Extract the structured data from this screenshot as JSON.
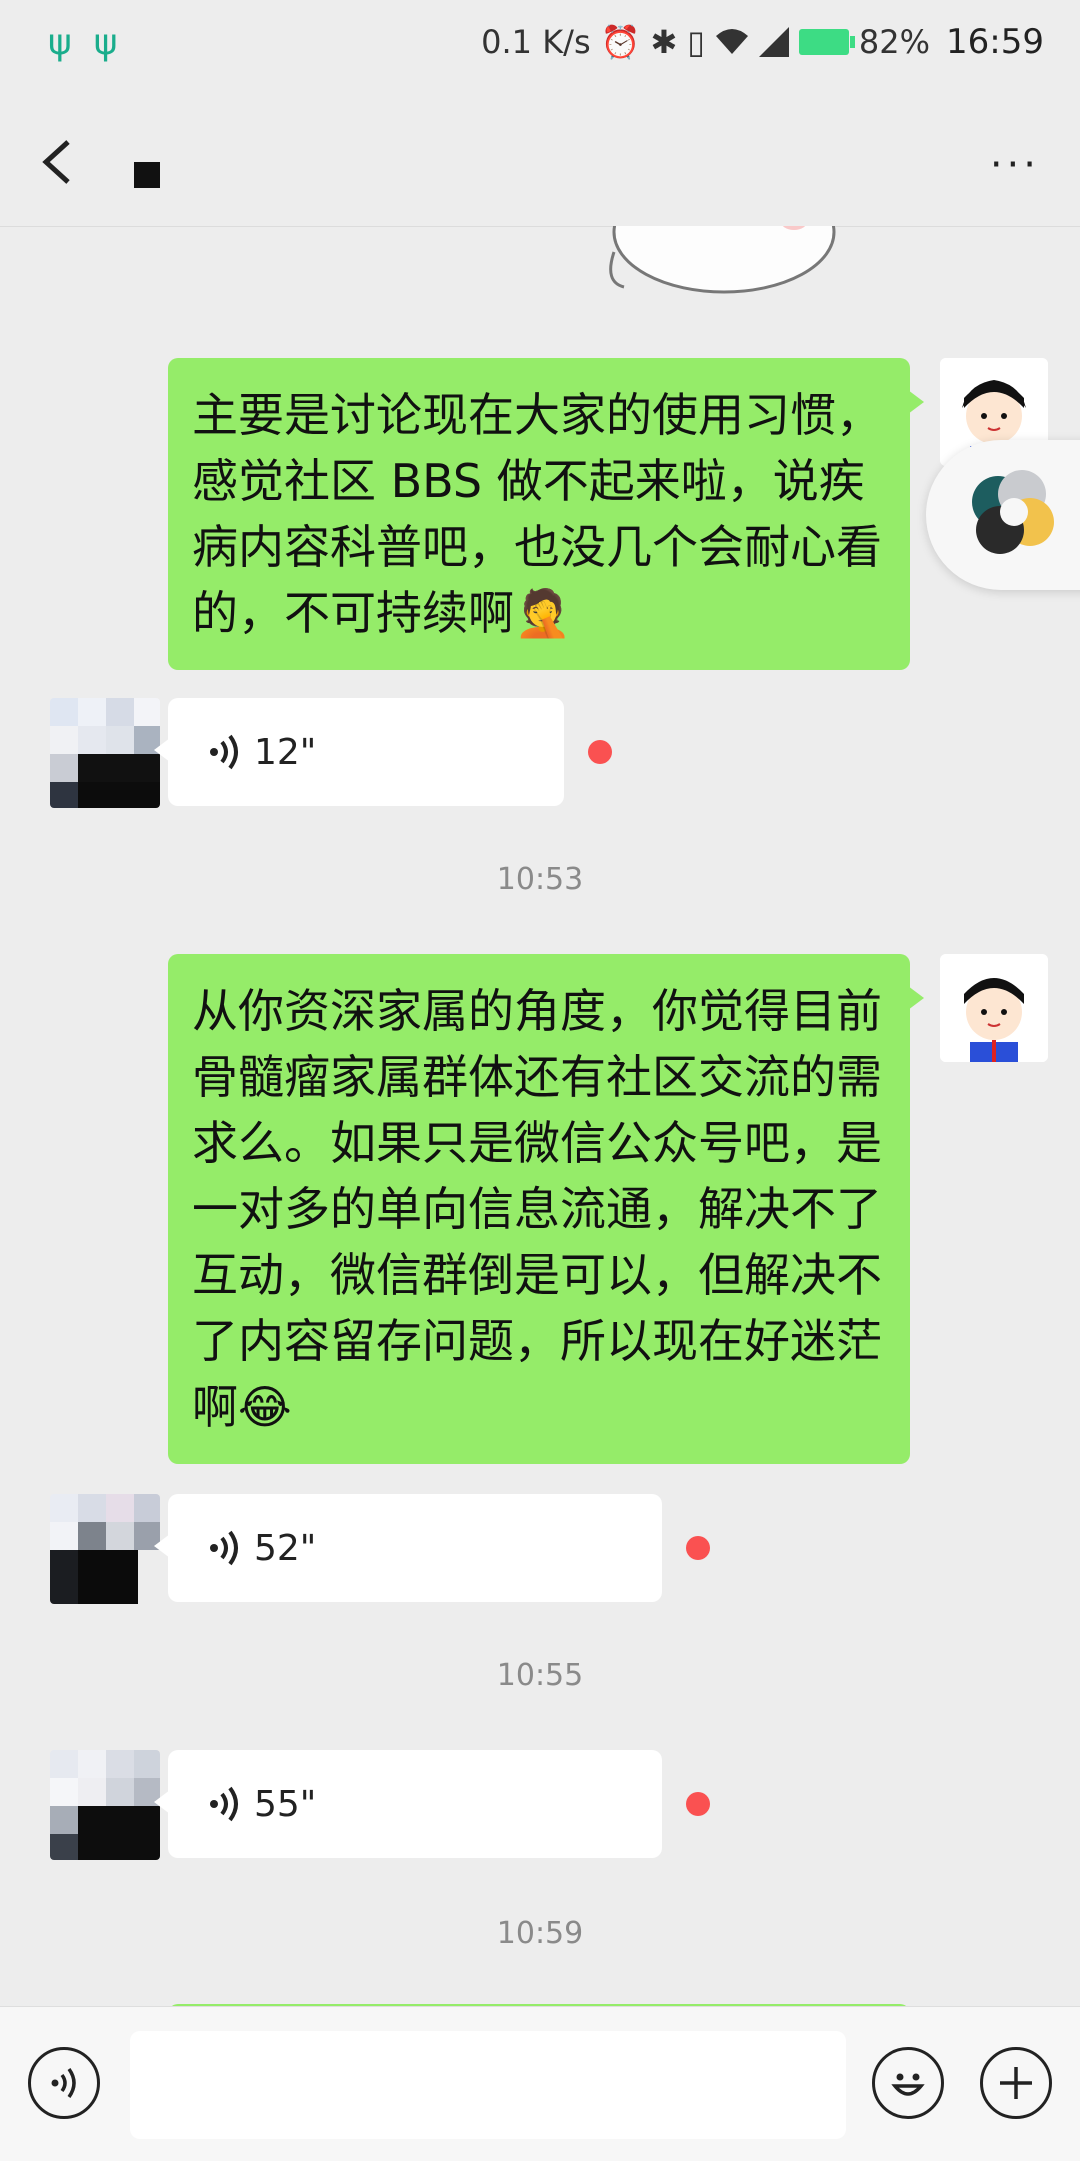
{
  "status_bar": {
    "left_icons": [
      "ψ",
      "ψ"
    ],
    "net_speed": "0.1 K/s",
    "battery_percent": "82%",
    "time": "16:59"
  },
  "header": {
    "back_icon": "chevron-left-icon",
    "more_icon": "···"
  },
  "messages": {
    "m1": {
      "type": "text_out",
      "text": "主要是讨论现在大家的使用习惯，感觉社区 BBS 做不起来啦，说疾病内容科普吧，也没几个会耐心看的，不可持续啊🤦"
    },
    "v1": {
      "type": "voice_in",
      "duration": "12\""
    },
    "t1": "10:53",
    "m2": {
      "type": "text_out",
      "text": "从你资深家属的角度，你觉得目前骨髓瘤家属群体还有社区交流的需求么。如果只是微信公众号吧，是一对多的单向信息流通，解决不了互动，微信群倒是可以，但解决不了内容留存问题，所以现在好迷茫啊😂"
    },
    "v2": {
      "type": "voice_in",
      "duration": "52\""
    },
    "t2": "10:55",
    "v3": {
      "type": "voice_in",
      "duration": "55\""
    },
    "t3": "10:59"
  },
  "colors": {
    "out_bubble": "#95ec69",
    "in_bubble": "#ffffff",
    "unread_dot": "#fa5151",
    "background": "#ededed"
  }
}
